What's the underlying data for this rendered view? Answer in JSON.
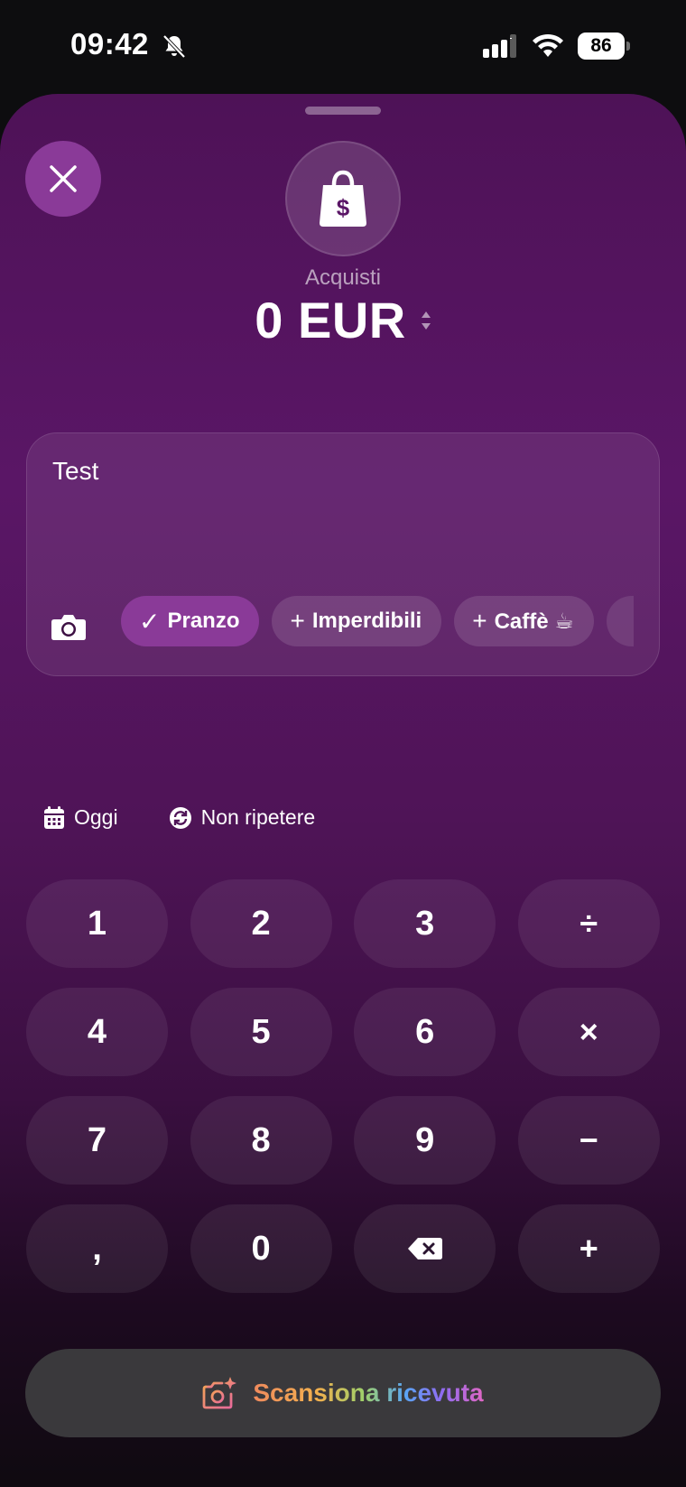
{
  "status_bar": {
    "time": "09:42",
    "battery": "86",
    "icons": [
      "bell-slash-icon",
      "cellular-signal-icon",
      "wifi-icon",
      "battery-icon"
    ]
  },
  "sheet": {
    "category": {
      "icon": "shopping-bag-dollar-icon",
      "label": "Acquisti"
    },
    "amount": "0 EUR",
    "note": {
      "text": "Test",
      "camera_icon": "camera-icon",
      "chips": [
        {
          "label": "Pranzo",
          "prefix": "✓",
          "selected": true
        },
        {
          "label": "Imperdibili",
          "prefix": "+",
          "selected": false
        },
        {
          "label": "Caffè ☕",
          "prefix": "+",
          "selected": false
        }
      ]
    },
    "options": {
      "date_label": "Oggi",
      "repeat_label": "Non ripetere"
    },
    "keypad": {
      "keys": [
        "1",
        "2",
        "3",
        "÷",
        "4",
        "5",
        "6",
        "×",
        "7",
        "8",
        "9",
        "−",
        ",",
        "0",
        "⌫",
        "+"
      ]
    },
    "scan_button": {
      "label": "Scansiona ricevuta",
      "icon": "camera-sparkle-icon"
    }
  },
  "colors": {
    "accent": "#8a3a98",
    "sheet_top": "#5a1666",
    "scan_button_bg": "#3a393c"
  }
}
